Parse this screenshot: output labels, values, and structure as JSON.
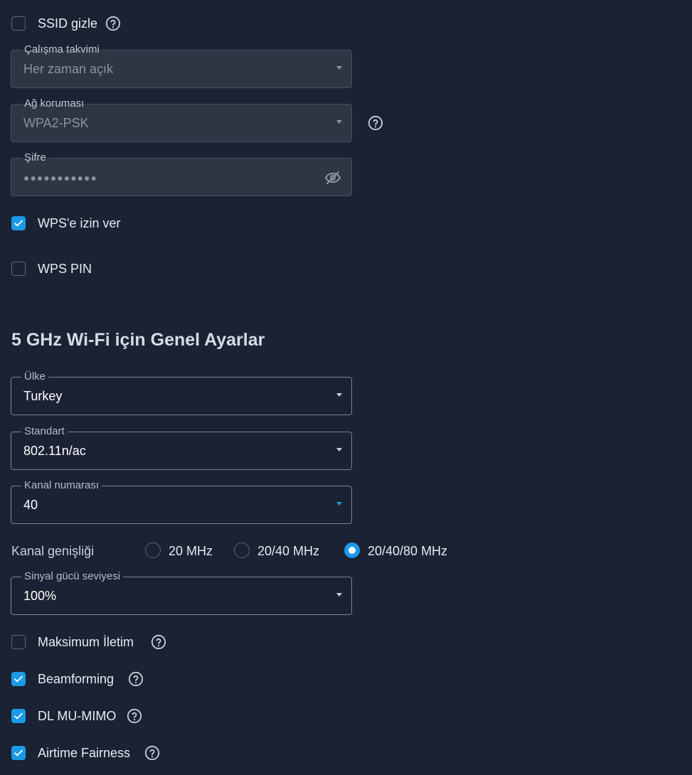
{
  "wifi24": {
    "hide_ssid": {
      "label": "SSID gizle",
      "checked": false
    },
    "schedule": {
      "label": "Çalışma takvimi",
      "value": "Her zaman açık"
    },
    "security": {
      "label": "Ağ koruması",
      "value": "WPA2-PSK"
    },
    "password": {
      "label": "Şifre",
      "value": "●●●●●●●●●●●"
    },
    "wps_allow": {
      "label": "WPS'e izin ver",
      "checked": true
    },
    "wps_pin": {
      "label": "WPS PIN",
      "checked": false
    }
  },
  "wifi5": {
    "heading": "5 GHz Wi-Fi için Genel Ayarlar",
    "country": {
      "label": "Ülke",
      "value": "Turkey"
    },
    "standard": {
      "label": "Standart",
      "value": "802.11n/ac"
    },
    "channel": {
      "label": "Kanal numarası",
      "value": "40"
    },
    "bandwidth": {
      "label": "Kanal genişliği",
      "options": [
        "20 MHz",
        "20/40 MHz",
        "20/40/80 MHz"
      ],
      "selected": "20/40/80 MHz"
    },
    "signal": {
      "label": "Sinyal gücü seviyesi",
      "value": "100%"
    },
    "max_transmission": {
      "label": "Maksimum İletim",
      "checked": false
    },
    "beamforming": {
      "label": "Beamforming",
      "checked": true
    },
    "dl_mu_mimo": {
      "label": "DL MU-MIMO",
      "checked": true
    },
    "airtime_fairness": {
      "label": "Airtime Fairness",
      "checked": true
    }
  },
  "colors": {
    "background": "#1b2233",
    "accent": "#1a9ae8",
    "disabled_field": "#2e3543"
  }
}
